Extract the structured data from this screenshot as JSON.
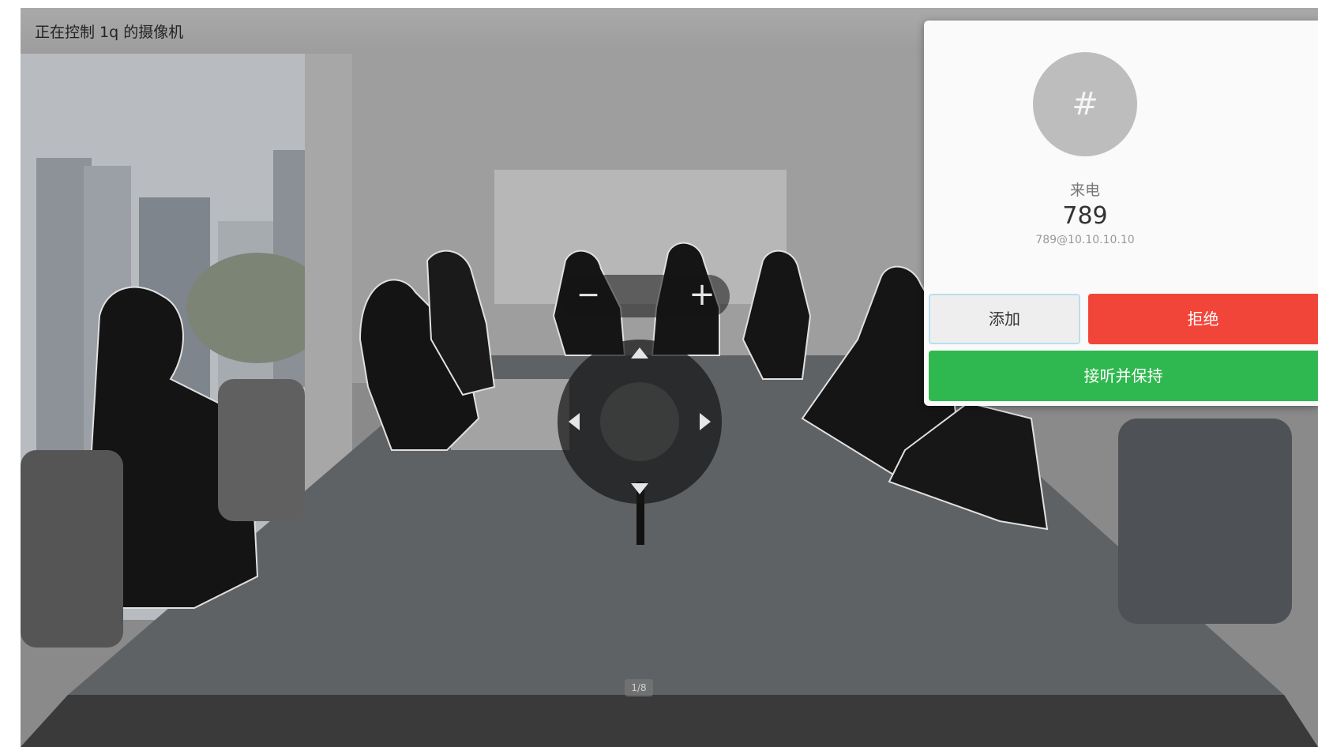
{
  "topbar": {
    "title": "正在控制 1q 的摄像机"
  },
  "camera_controls": {
    "zoom_out_glyph": "−",
    "zoom_in_glyph": "+",
    "icons": [
      "zoom-out-icon",
      "zoom-in-icon",
      "arrow-up-icon",
      "arrow-down-icon",
      "arrow-left-icon",
      "arrow-right-icon"
    ]
  },
  "bottom_badge": {
    "text": "1/8"
  },
  "incoming_call": {
    "avatar_glyph": "#",
    "label": "来电",
    "number": "789",
    "uri": "789@10.10.10.10",
    "add_label": "添加",
    "reject_label": "拒绝",
    "answer_hold_label": "接听并保持"
  },
  "colors": {
    "reject": "#f2453a",
    "answer": "#2fb84f",
    "add_border": "#b9dfef",
    "topbar": "#a3a3a3"
  }
}
